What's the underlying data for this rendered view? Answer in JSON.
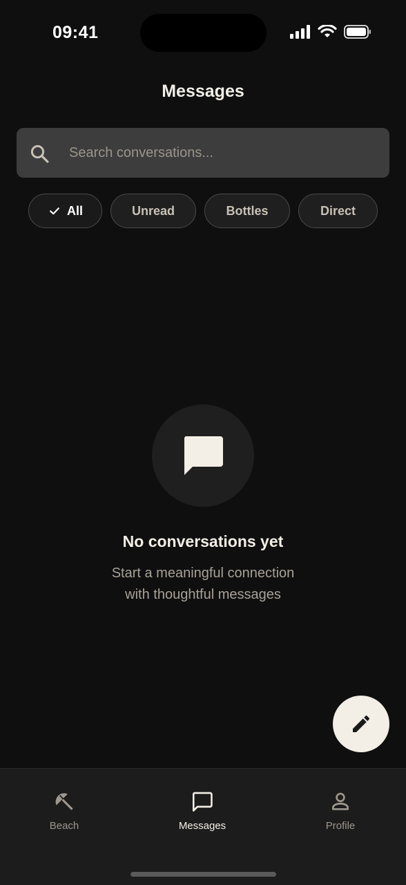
{
  "status_bar": {
    "time": "09:41",
    "icons": [
      "signal-icon",
      "wifi-icon",
      "battery-icon"
    ]
  },
  "header": {
    "title": "Messages"
  },
  "search": {
    "placeholder": "Search conversations...",
    "value": "",
    "icon": "search-icon"
  },
  "filters": [
    {
      "label": "All",
      "selected": true
    },
    {
      "label": "Unread",
      "selected": false
    },
    {
      "label": "Bottles",
      "selected": false
    },
    {
      "label": "Direct",
      "selected": false
    }
  ],
  "empty_state": {
    "icon": "chat-bubble-icon",
    "title": "No conversations yet",
    "subtitle_line1": "Start a meaningful connection",
    "subtitle_line2": "with thoughtful messages"
  },
  "fab": {
    "icon": "pencil-icon"
  },
  "bottom_nav": {
    "items": [
      {
        "label": "Beach",
        "icon": "beach-umbrella-icon",
        "active": false
      },
      {
        "label": "Messages",
        "icon": "chat-bubble-outline-icon",
        "active": true
      },
      {
        "label": "Profile",
        "icon": "person-icon",
        "active": false
      }
    ]
  },
  "colors": {
    "background": "#0f0f0f",
    "accent_cream": "#f3efe6",
    "surface": "#1f1f1f",
    "search_bg": "#3d3d3d",
    "muted_text": "#a8a298"
  }
}
